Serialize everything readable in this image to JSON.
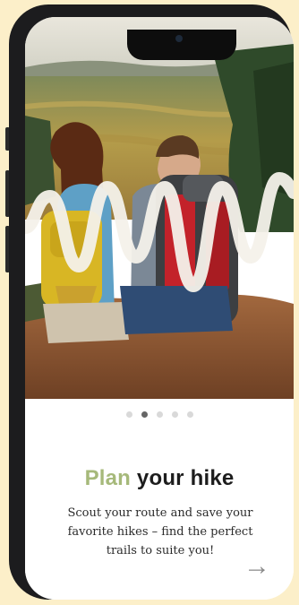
{
  "onboarding": {
    "title_accent": "Plan",
    "title_rest": " your hike",
    "description": "Scout your route and save your favorite hikes – find the perfect trails to suite you!",
    "next_icon": "→",
    "dots": {
      "total": 5,
      "active_index": 1
    }
  },
  "colors": {
    "accent": "#a6b97a",
    "background": "#fcefc9",
    "dot_active": "#666666",
    "dot_inactive": "#d9d9d9"
  }
}
